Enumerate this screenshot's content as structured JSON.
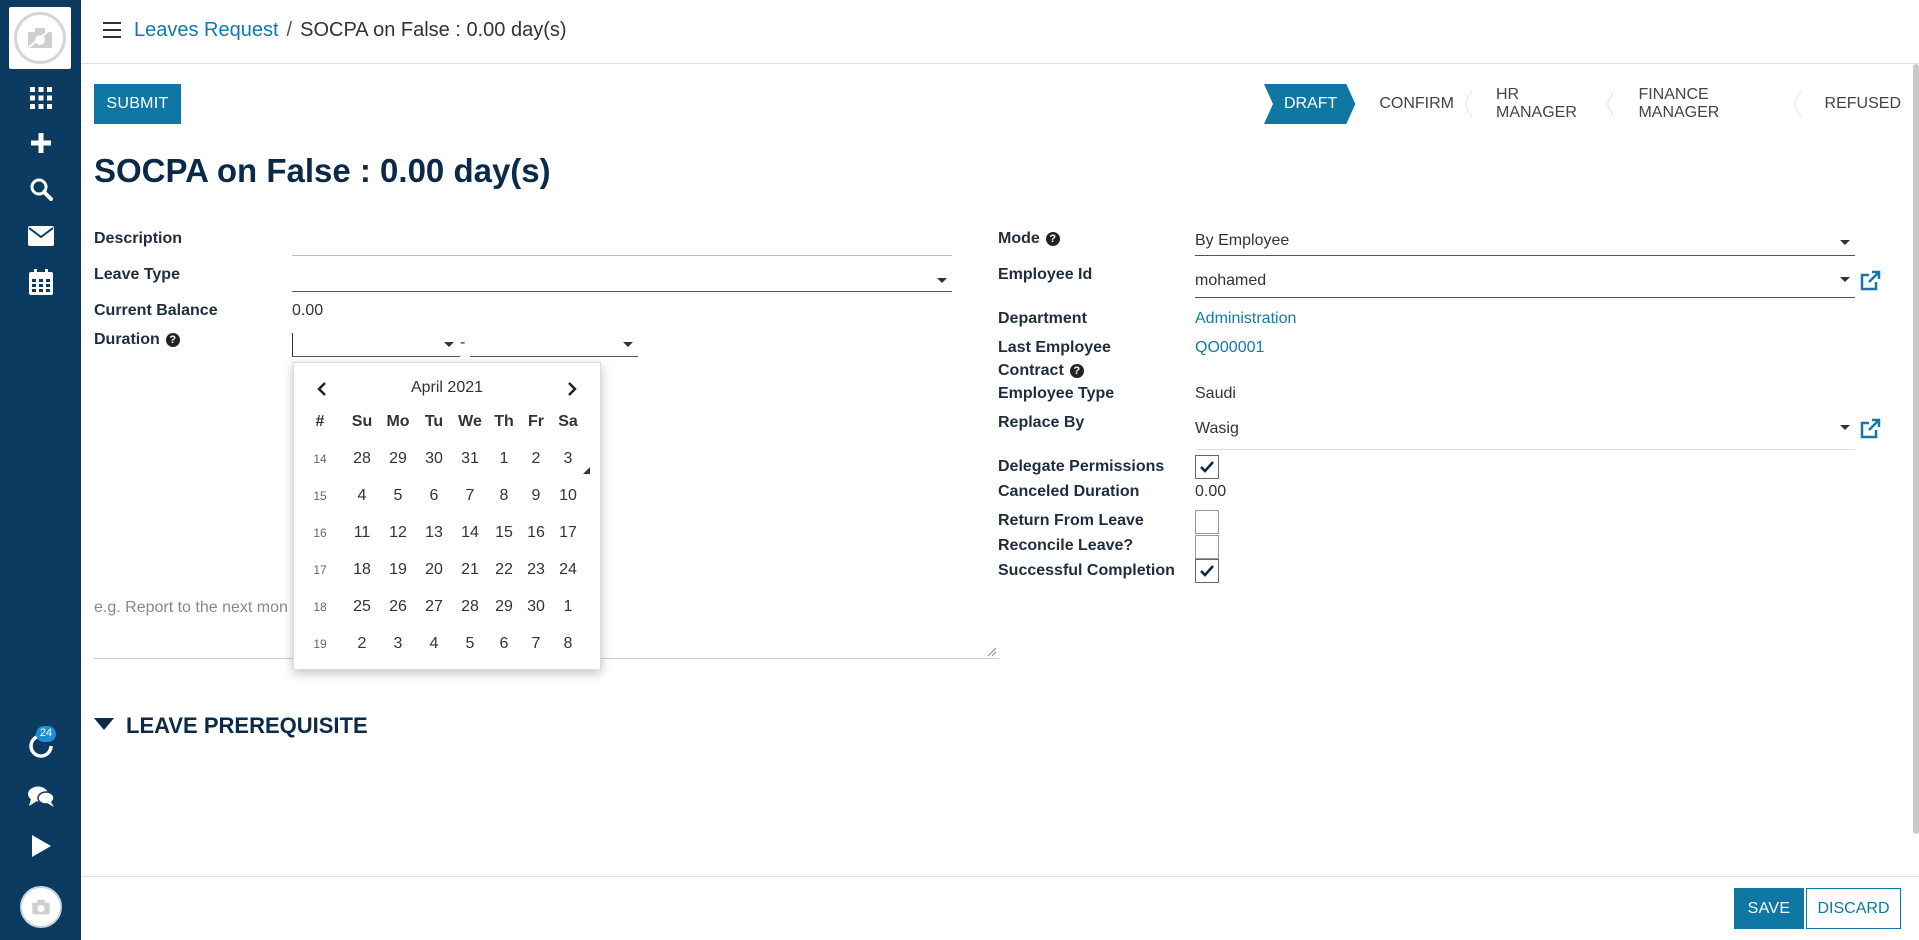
{
  "sidebar": {
    "items": [
      {
        "name": "apps-icon"
      },
      {
        "name": "plus-icon"
      },
      {
        "name": "search-icon"
      },
      {
        "name": "mail-icon"
      },
      {
        "name": "calendar-icon"
      }
    ],
    "activity_badge": "24"
  },
  "breadcrumb": {
    "parent": "Leaves Request",
    "separator": "/",
    "current": "SOCPA on False : 0.00 day(s)"
  },
  "actions": {
    "submit": "SUBMIT",
    "save": "SAVE",
    "discard": "DISCARD"
  },
  "status": {
    "stages": [
      "DRAFT",
      "CONFIRM",
      "HR MANAGER",
      "FINANCE MANAGER",
      "REFUSED"
    ],
    "active": "DRAFT"
  },
  "form": {
    "title": "SOCPA on False : 0.00 day(s)",
    "left": {
      "description_label": "Description",
      "leave_type_label": "Leave Type",
      "current_balance_label": "Current Balance",
      "current_balance_value": "0.00",
      "duration_label": "Duration",
      "duration_separator": "-",
      "notes_placeholder": "e.g. Report to the next mon"
    },
    "right": {
      "mode_label": "Mode",
      "mode_value": "By Employee",
      "employee_id_label": "Employee Id",
      "employee_id_value": "mohamed",
      "department_label": "Department",
      "department_value": "Administration",
      "last_contract_label_1": "Last Employee",
      "last_contract_label_2": "Contract",
      "last_contract_value": "QO00001",
      "employee_type_label": "Employee Type",
      "employee_type_value": "Saudi",
      "replace_by_label": "Replace By",
      "replace_by_value": "Wasig",
      "delegate_permissions_label": "Delegate Permissions",
      "delegate_permissions_checked": true,
      "canceled_duration_label": "Canceled Duration",
      "canceled_duration_value": "0.00",
      "return_from_leave_label": "Return From Leave",
      "return_from_leave_checked": false,
      "reconcile_leave_label": "Reconcile Leave?",
      "reconcile_leave_checked": false,
      "successful_completion_label": "Successful Completion",
      "successful_completion_checked": true
    }
  },
  "datepicker": {
    "month_label": "April 2021",
    "headers": [
      "#",
      "Su",
      "Mo",
      "Tu",
      "We",
      "Th",
      "Fr",
      "Sa"
    ],
    "weeks": [
      {
        "week": "14",
        "days": [
          "28",
          "29",
          "30",
          "31",
          "1",
          "2",
          "3"
        ]
      },
      {
        "week": "15",
        "days": [
          "4",
          "5",
          "6",
          "7",
          "8",
          "9",
          "10"
        ]
      },
      {
        "week": "16",
        "days": [
          "11",
          "12",
          "13",
          "14",
          "15",
          "16",
          "17"
        ]
      },
      {
        "week": "17",
        "days": [
          "18",
          "19",
          "20",
          "21",
          "22",
          "23",
          "24"
        ]
      },
      {
        "week": "18",
        "days": [
          "25",
          "26",
          "27",
          "28",
          "29",
          "30",
          "1"
        ]
      },
      {
        "week": "19",
        "days": [
          "2",
          "3",
          "4",
          "5",
          "6",
          "7",
          "8"
        ]
      }
    ]
  },
  "section": {
    "leave_prerequisite": "LEAVE PREREQUISITE"
  }
}
